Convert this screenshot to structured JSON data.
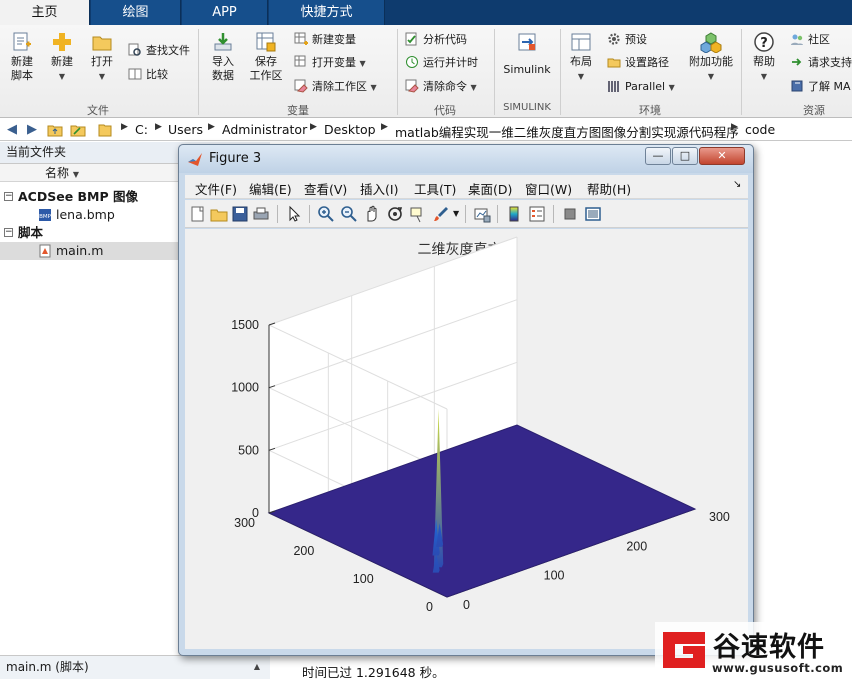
{
  "tabs": {
    "home": "主页",
    "plot": "绘图",
    "app": "APP",
    "shortcuts": "快捷方式"
  },
  "ribbon": {
    "file": {
      "new_script": "新建\n脚本",
      "new": "新建",
      "open": "打开",
      "find_files": "查找文件",
      "compare": "比较",
      "group_label": "文件"
    },
    "variable": {
      "import_data": "导入\n数据",
      "save_workspace": "保存\n工作区",
      "new_variable": "新建变量",
      "open_variable": "打开变量",
      "clear_workspace": "清除工作区",
      "group_label": "变量"
    },
    "code": {
      "analyze_code": "分析代码",
      "run_and_time": "运行并计时",
      "clear_commands": "清除命令",
      "group_label": "代码"
    },
    "simulink": {
      "label": "Simulink",
      "group_label": "SIMULINK"
    },
    "environment": {
      "layout": "布局",
      "preferences": "预设",
      "set_path": "设置路径",
      "parallel": "Parallel",
      "addons": "附加功能",
      "group_label": "环境"
    },
    "resources": {
      "help": "帮助",
      "community": "社区",
      "request_support": "请求支持",
      "learn_matlab": "了解 MA",
      "group_label": "资源"
    }
  },
  "address": {
    "crumbs": [
      "C:",
      "Users",
      "Administrator",
      "Desktop",
      "matlab编程实现一维二维灰度直方图图像分割实现源代码程序",
      "code"
    ]
  },
  "current_folder": {
    "title": "当前文件夹",
    "name_column": "名称",
    "groups": [
      {
        "label": "ACDSee BMP 图像",
        "files": [
          "lena.bmp"
        ]
      },
      {
        "label": "脚本",
        "files": [
          "main.m"
        ]
      }
    ],
    "status": "main.m  (脚本)"
  },
  "command_window": {
    "last_line": "时间已过 1.291648 秒。"
  },
  "figure": {
    "window_title": "Figure 3",
    "window_buttons": {
      "minimize": "—",
      "maximize": "□",
      "close": "✕"
    },
    "menu": [
      "文件(F)",
      "编辑(E)",
      "查看(V)",
      "插入(I)",
      "工具(T)",
      "桌面(D)",
      "窗口(W)",
      "帮助(H)"
    ]
  },
  "chart_data": {
    "type": "surface",
    "title": "二维灰度直方图",
    "xlabel": "",
    "ylabel": "",
    "zlabel": "",
    "xlim": [
      0,
      300
    ],
    "ylim": [
      0,
      300
    ],
    "zlim": [
      0,
      1500
    ],
    "xticks": [
      0,
      100,
      200,
      300
    ],
    "yticks": [
      0,
      100,
      200,
      300
    ],
    "zticks": [
      0,
      500,
      1000,
      1500
    ],
    "grid": true,
    "colormap": "parula",
    "base_color": "#35278a",
    "peaks": [
      {
        "x": 40,
        "y": 70,
        "z": 1250
      },
      {
        "x": 55,
        "y": 95,
        "z": 280
      },
      {
        "x": 70,
        "y": 110,
        "z": 180
      },
      {
        "x": 30,
        "y": 60,
        "z": 140
      }
    ]
  },
  "watermark": {
    "brand": "谷速软件",
    "url": "www.gususoft.com"
  }
}
